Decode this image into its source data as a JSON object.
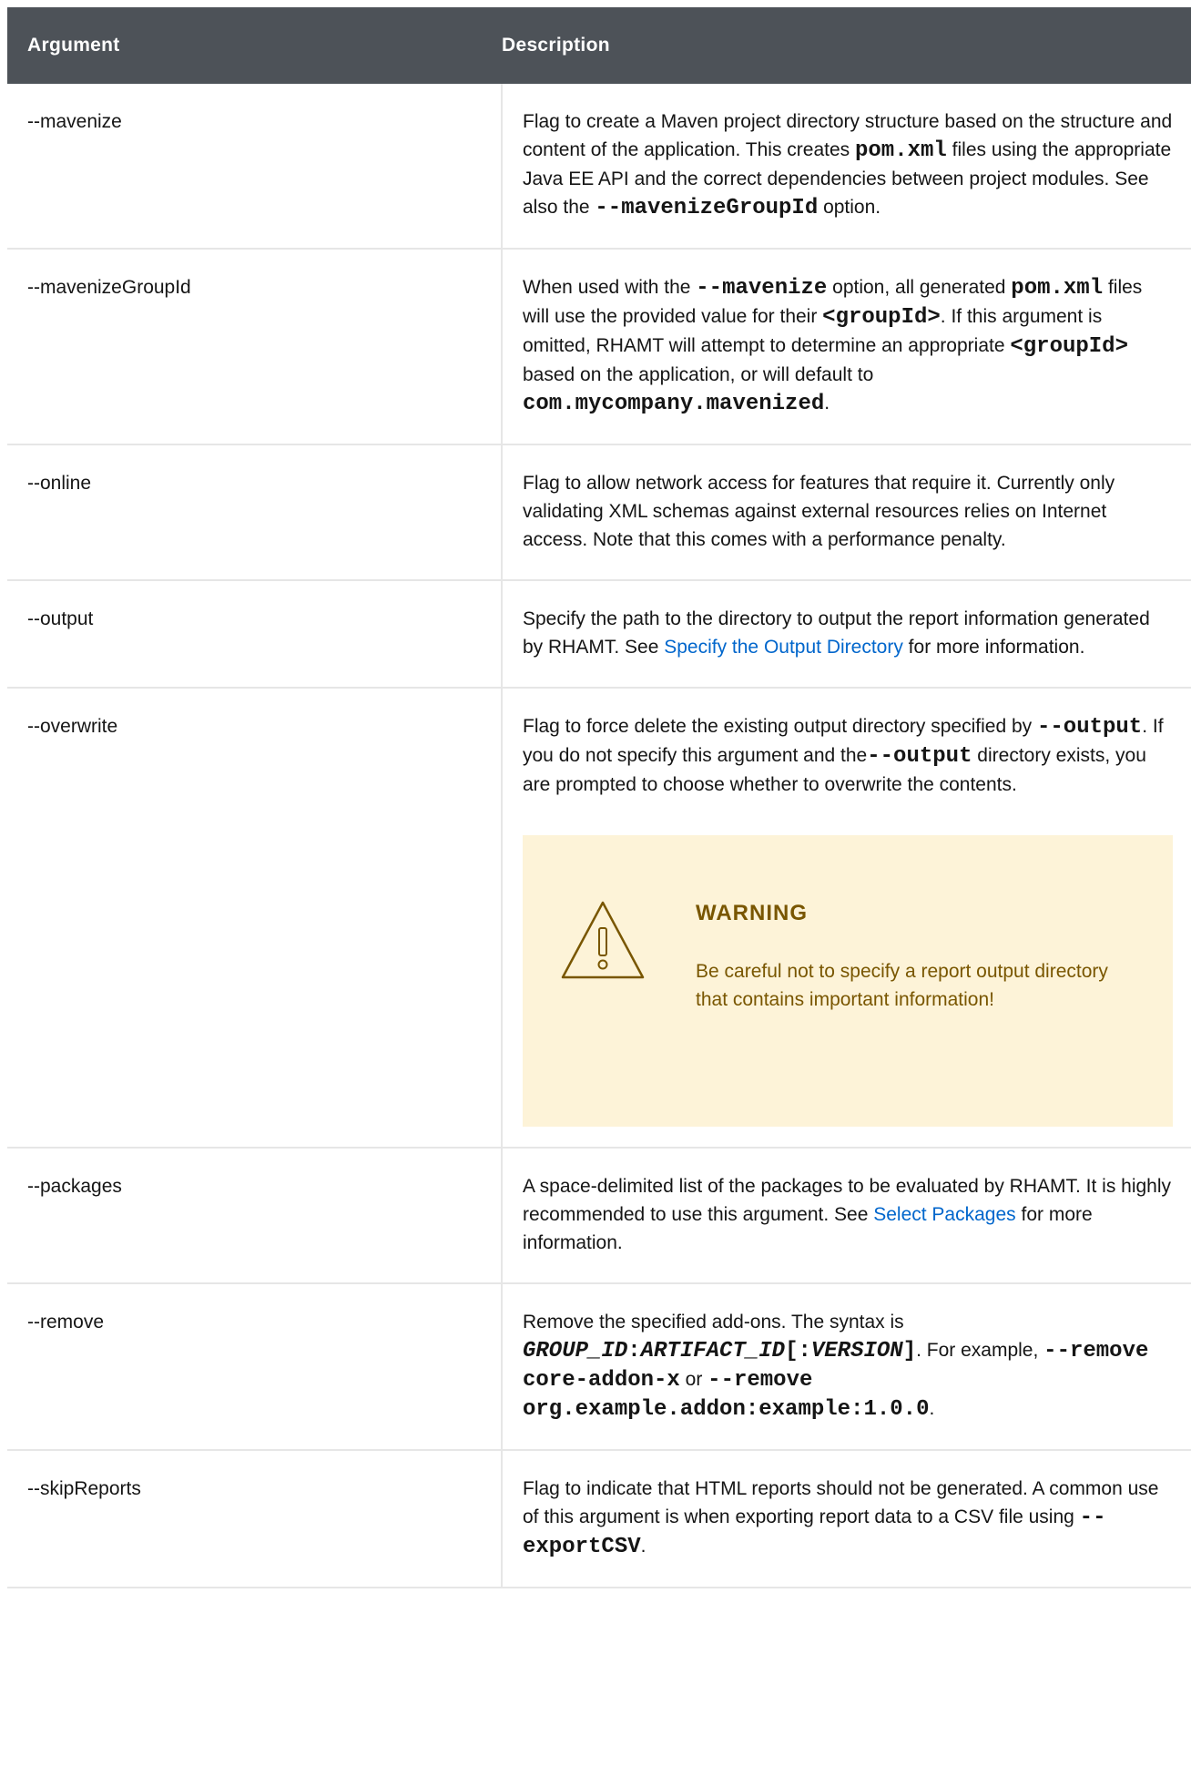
{
  "header": {
    "argument": "Argument",
    "description": "Description"
  },
  "rows": {
    "mavenize": {
      "arg": "--mavenize",
      "t1": "Flag to create a Maven project directory structure based on the structure and content of the application. This creates ",
      "c1": "pom.xml",
      "t2": " files using the appropriate Java EE API and the correct dependencies between project modules. See also the ",
      "c2": "--mavenizeGroupId",
      "t3": " option."
    },
    "mavenizeGroupId": {
      "arg": "--mavenizeGroupId",
      "t1": "When used with the ",
      "c1": "--mavenize",
      "t2": " option, all generated ",
      "c2": "pom.xml",
      "t3": " files will use the provided value for their ",
      "c3": "<groupId>",
      "t4": ". If this argument is omitted, RHAMT will attempt to determine an appropriate ",
      "c4": "<groupId>",
      "t5": " based on the application, or will default to ",
      "c5": "com.mycompany.mavenized",
      "t6": "."
    },
    "online": {
      "arg": "--online",
      "t1": "Flag to allow network access for features that require it. Currently only validating XML schemas against external resources relies on Internet access. Note that this comes with a performance penalty."
    },
    "output": {
      "arg": "--output",
      "t1": "Specify the path to the directory to output the report information generated by RHAMT. See ",
      "link": "Specify the Output Directory",
      "t2": " for more information."
    },
    "overwrite": {
      "arg": "--overwrite",
      "t1": "Flag to force delete the existing output directory specified by ",
      "c1": "--output",
      "t2": ". If you do not specify this argument and the",
      "c2": "--output",
      "t3": " directory exists, you are prompted to choose whether to overwrite the contents.",
      "warning_title": "WARNING",
      "warning_body": "Be careful not to specify a report output directory that contains important information!",
      "warning_color": "#795600",
      "warning_bg": "#fdf3d8"
    },
    "packages": {
      "arg": "--packages",
      "t1": "A space-delimited list of the packages to be evaluated by RHAMT. It is highly recommended to use this argument. See ",
      "link": "Select Packages",
      "t2": " for more information."
    },
    "remove": {
      "arg": "--remove",
      "t1": "Remove the specified add-ons. The syntax is ",
      "ci1": "GROUP_ID",
      "c1": ":",
      "ci2": "ARTIFACT_ID",
      "c2": "[:",
      "ci3": "VERSION",
      "c3": "]",
      "t2": ". For example, ",
      "c4": "--remove core-addon-x",
      "t3": " or ",
      "c5": "--remove org.example.addon:example:1.0.0",
      "t4": "."
    },
    "skipReports": {
      "arg": "--skipReports",
      "t1": "Flag to indicate that HTML reports should not be generated. A common use of this argument is when exporting report data to a CSV file using ",
      "c1": "--exportCSV",
      "t2": "."
    }
  },
  "colors": {
    "header_bg": "#4d5258",
    "link": "#0066cc",
    "border": "#e6e6e6"
  }
}
